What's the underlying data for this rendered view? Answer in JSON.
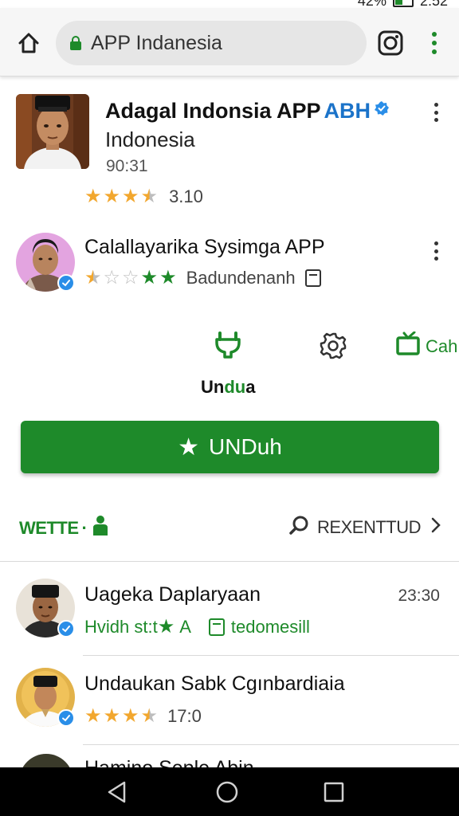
{
  "status": {
    "battery_percent": "42%",
    "time": "2:52",
    "battery_level": 0.42
  },
  "browser": {
    "url": "APP Indanesia",
    "home_icon": "home-icon",
    "lock_icon": "lock-icon",
    "instagram_icon": "instagram-icon",
    "menu_icon": "more-vert-icon"
  },
  "app_header": {
    "title": "Adagal Indonsia APP",
    "tag": "ABH",
    "subtitle": "Indonesia",
    "time": "90:31",
    "rating_value": "3.10",
    "rating_stars": 3.5
  },
  "second_card": {
    "name": "Calallayarika Sysimga APP",
    "meta_label": "Badundenanh",
    "stars": [
      "half-gold",
      "empty",
      "empty",
      "green",
      "green"
    ]
  },
  "actions": {
    "download_label_prefix": "Un",
    "download_label_mid": "du",
    "download_label_suffix": "a",
    "cah_label": "Cah",
    "icons": [
      "plug-icon",
      "settings-icon",
      "tv-icon"
    ]
  },
  "primary_button": {
    "label": "UNDuh"
  },
  "tabs": {
    "left_label": "WETTE",
    "left_dot": "·",
    "right_label": "REXENTTUD"
  },
  "list": [
    {
      "title": "Uageka Daplaryaan",
      "time": "23:30",
      "sub_text": "Hvidh st:t",
      "sub_star_label": "A",
      "tag": "tedomesill"
    },
    {
      "title": "Undaukan Sabk Cgınbardiaia",
      "rating_value": "17:0",
      "rating_stars": 3.5
    },
    {
      "title": "Hamino Seple Abin"
    }
  ],
  "colors": {
    "accent_green": "#1e8a2a",
    "star_gold": "#f2a72e",
    "link_blue": "#1b73c9"
  }
}
